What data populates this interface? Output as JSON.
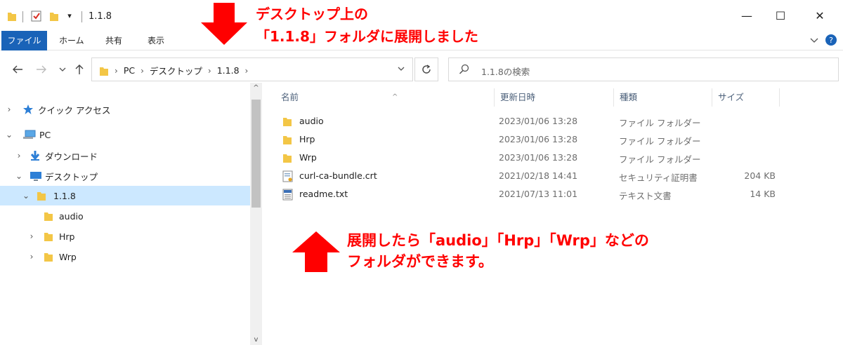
{
  "window": {
    "title": "1.1.8",
    "minimize_glyph": "—",
    "maximize_glyph": "☐",
    "close_glyph": "✕"
  },
  "ribbon": {
    "tabs": [
      "ファイル",
      "ホーム",
      "共有",
      "表示"
    ]
  },
  "address": {
    "crumbs": [
      "PC",
      "デスクトップ",
      "1.1.8"
    ]
  },
  "search": {
    "placeholder": "1.1.8の検索"
  },
  "sidebar": {
    "items": [
      {
        "label": "クイック アクセス",
        "icon": "star-icon"
      },
      {
        "label": "PC",
        "icon": "pc-icon"
      },
      {
        "label": "ダウンロード",
        "icon": "download-icon"
      },
      {
        "label": "デスクトップ",
        "icon": "desktop-icon"
      },
      {
        "label": "1.1.8",
        "icon": "folder-icon",
        "selected": true
      },
      {
        "label": "audio",
        "icon": "folder-icon"
      },
      {
        "label": "Hrp",
        "icon": "folder-icon"
      },
      {
        "label": "Wrp",
        "icon": "folder-icon"
      }
    ]
  },
  "filelist": {
    "columns": [
      "名前",
      "更新日時",
      "種類",
      "サイズ"
    ],
    "rows": [
      {
        "name": "audio",
        "date": "2023/01/06 13:28",
        "type": "ファイル フォルダー",
        "size": "",
        "icon": "folder-icon"
      },
      {
        "name": "Hrp",
        "date": "2023/01/06 13:28",
        "type": "ファイル フォルダー",
        "size": "",
        "icon": "folder-icon"
      },
      {
        "name": "Wrp",
        "date": "2023/01/06 13:28",
        "type": "ファイル フォルダー",
        "size": "",
        "icon": "folder-icon"
      },
      {
        "name": "curl-ca-bundle.crt",
        "date": "2021/02/18 14:41",
        "type": "セキュリティ証明書",
        "size": "204 KB",
        "icon": "certificate-icon"
      },
      {
        "name": "readme.txt",
        "date": "2021/07/13 11:01",
        "type": "テキスト文書",
        "size": "14 KB",
        "icon": "text-file-icon"
      }
    ]
  },
  "annotations": {
    "top_line1": "デスクトップ上の",
    "top_line2": "「1.1.8」フォルダに展開しました",
    "bottom_line1": "展開したら「audio」「Hrp」「Wrp」などの",
    "bottom_line2": "フォルダができます。"
  },
  "colors": {
    "accent": "#1a63b8",
    "selection": "#cce8ff",
    "folder": "#f3c646",
    "annotation": "#ff0000"
  }
}
